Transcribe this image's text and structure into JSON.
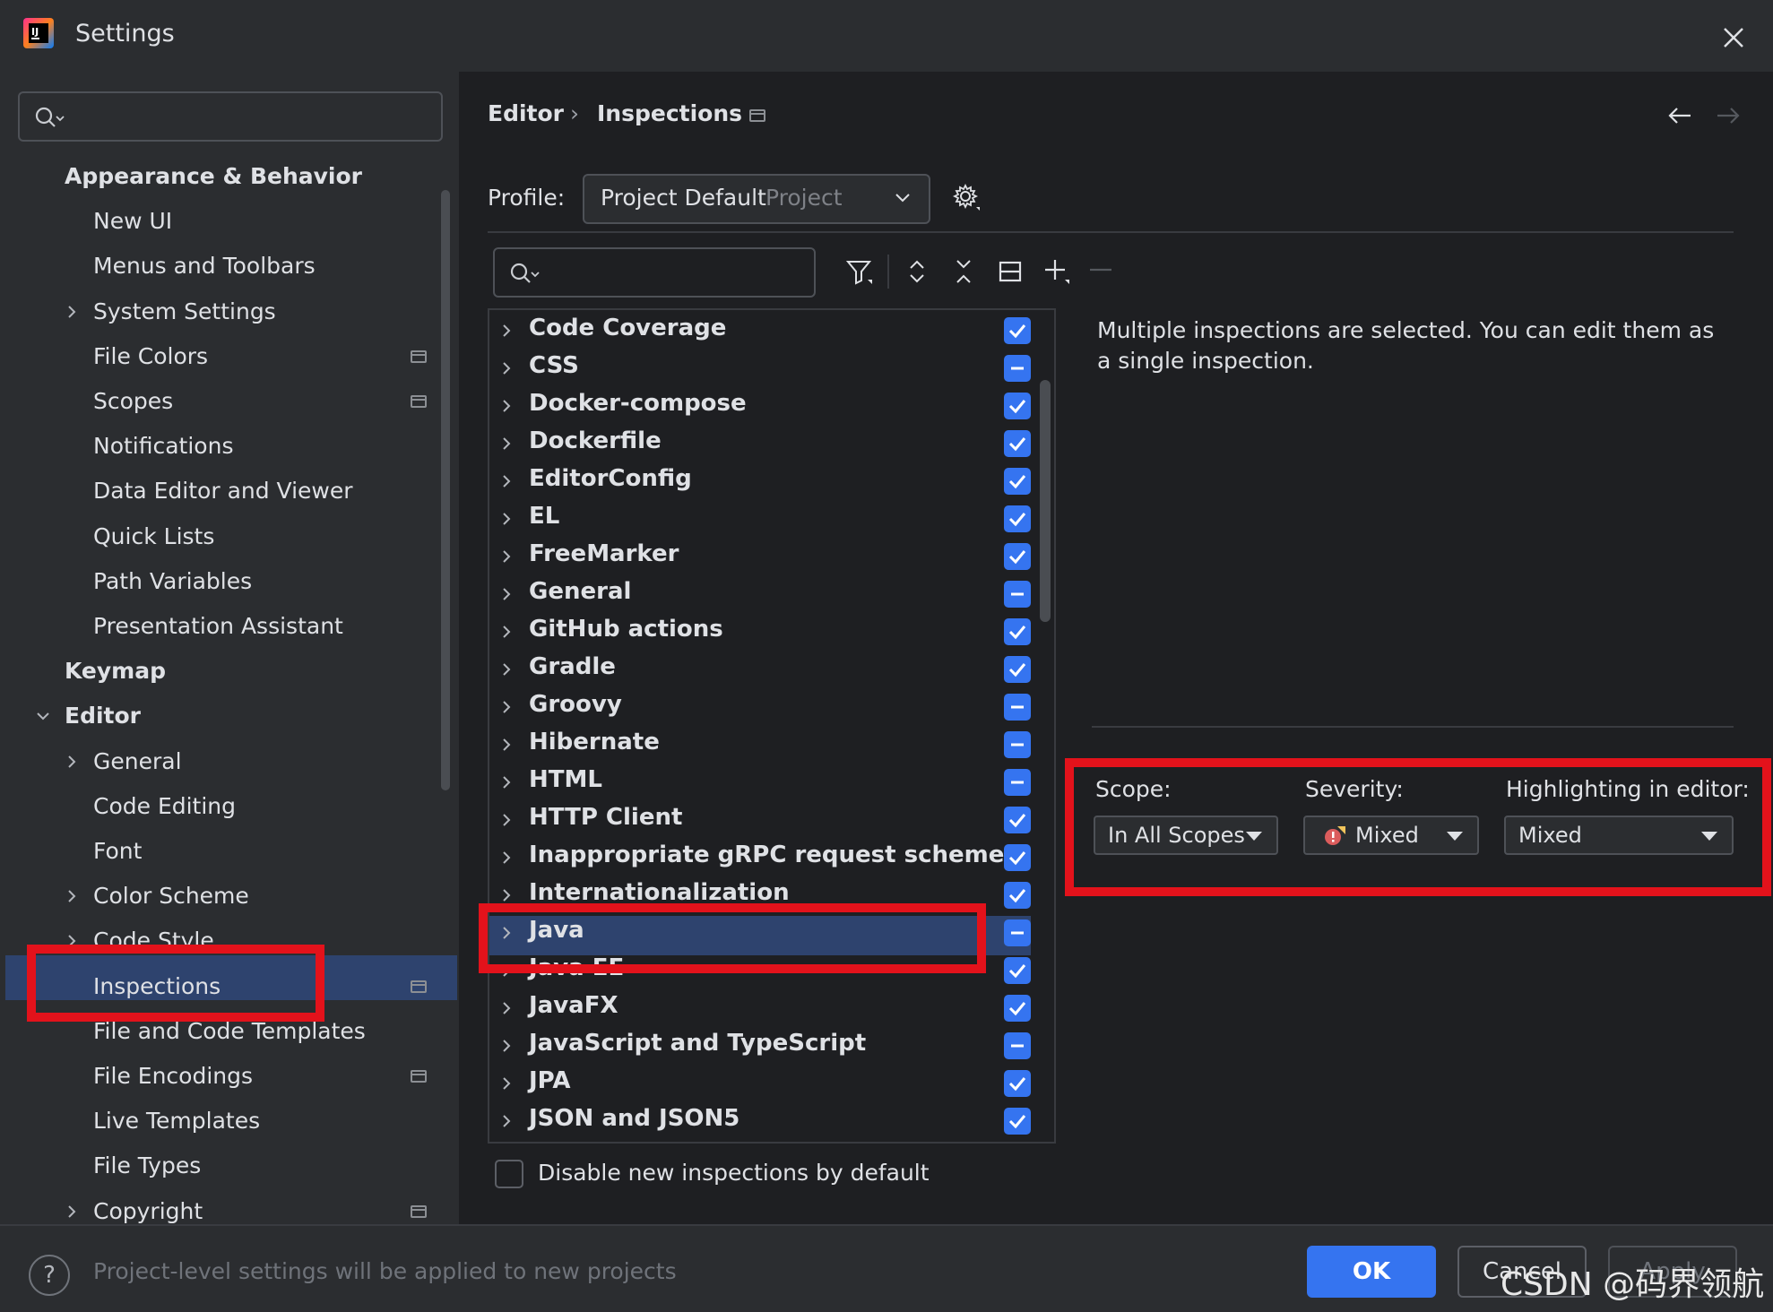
{
  "window": {
    "title": "Settings"
  },
  "sidebar": {
    "search_placeholder": "",
    "items": [
      {
        "label": "Appearance & Behavior",
        "bold": true
      },
      {
        "label": "New UI"
      },
      {
        "label": "Menus and Toolbars"
      },
      {
        "label": "System Settings"
      },
      {
        "label": "File Colors"
      },
      {
        "label": "Scopes"
      },
      {
        "label": "Notifications"
      },
      {
        "label": "Data Editor and Viewer"
      },
      {
        "label": "Quick Lists"
      },
      {
        "label": "Path Variables"
      },
      {
        "label": "Presentation Assistant"
      },
      {
        "label": "Keymap",
        "bold": true
      },
      {
        "label": "Editor",
        "bold": true
      },
      {
        "label": "General"
      },
      {
        "label": "Code Editing"
      },
      {
        "label": "Font"
      },
      {
        "label": "Color Scheme"
      },
      {
        "label": "Code Style"
      },
      {
        "label": "Inspections",
        "selected": true
      },
      {
        "label": "File and Code Templates"
      },
      {
        "label": "File Encodings"
      },
      {
        "label": "Live Templates"
      },
      {
        "label": "File Types"
      },
      {
        "label": "Copyright"
      }
    ]
  },
  "breadcrumb": {
    "parent": "Editor",
    "separator": "›",
    "current": "Inspections"
  },
  "profile": {
    "label": "Profile:",
    "value": "Project Default",
    "scope": "Project"
  },
  "tree": {
    "search_placeholder": "",
    "rows": [
      {
        "label": "Code Coverage",
        "state": "checked"
      },
      {
        "label": "CSS",
        "state": "mixed"
      },
      {
        "label": "Docker-compose",
        "state": "checked"
      },
      {
        "label": "Dockerfile",
        "state": "checked"
      },
      {
        "label": "EditorConfig",
        "state": "checked"
      },
      {
        "label": "EL",
        "state": "checked"
      },
      {
        "label": "FreeMarker",
        "state": "checked"
      },
      {
        "label": "General",
        "state": "mixed"
      },
      {
        "label": "GitHub actions",
        "state": "checked"
      },
      {
        "label": "Gradle",
        "state": "checked"
      },
      {
        "label": "Groovy",
        "state": "mixed"
      },
      {
        "label": "Hibernate",
        "state": "mixed"
      },
      {
        "label": "HTML",
        "state": "mixed"
      },
      {
        "label": "HTTP Client",
        "state": "checked"
      },
      {
        "label": "Inappropriate gRPC request scheme",
        "state": "checked"
      },
      {
        "label": "Internationalization",
        "state": "checked"
      },
      {
        "label": "Java",
        "state": "mixed",
        "selected": true
      },
      {
        "label": "Java EE",
        "state": "checked"
      },
      {
        "label": "JavaFX",
        "state": "checked"
      },
      {
        "label": "JavaScript and TypeScript",
        "state": "mixed"
      },
      {
        "label": "JPA",
        "state": "checked"
      },
      {
        "label": "JSON and JSON5",
        "state": "checked"
      }
    ]
  },
  "description": "Multiple inspections are selected. You can edit them as a single inspection.",
  "options": {
    "scope_label": "Scope:",
    "scope_value": "In All Scopes",
    "severity_label": "Severity:",
    "severity_value": "Mixed",
    "highlight_label": "Highlighting in editor:",
    "highlight_value": "Mixed"
  },
  "disable_new": {
    "label": "Disable new inspections by default",
    "checked": false
  },
  "footer": {
    "message": "Project-level settings will be applied to new projects",
    "help": "?",
    "ok": "OK",
    "cancel": "Cancel",
    "apply": "Apply"
  },
  "watermark": "CSDN @码界领航",
  "colors": {
    "accent": "#3574f0",
    "selection": "#2e436e",
    "highlight_box": "#e3121b"
  }
}
